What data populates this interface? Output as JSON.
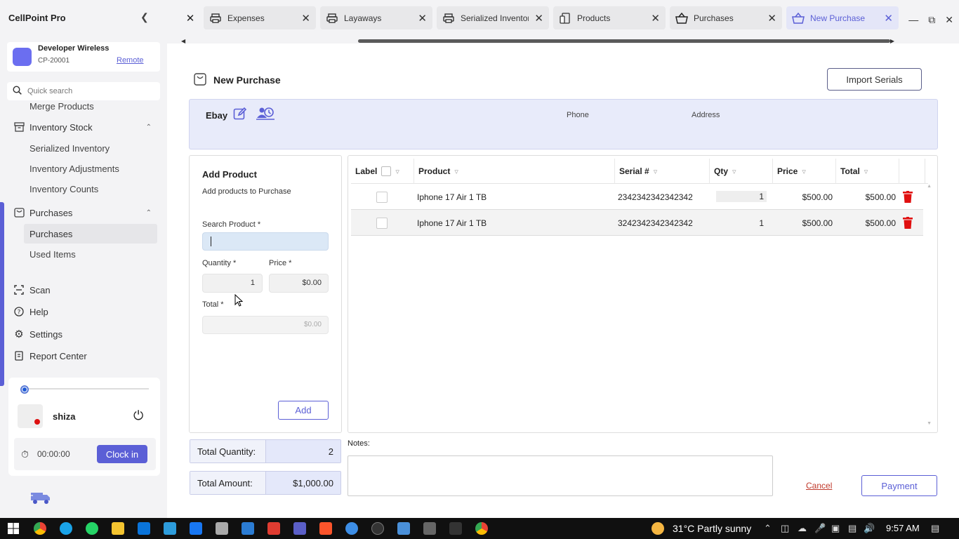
{
  "app": {
    "title": "CellPoint Pro"
  },
  "tabs": [
    {
      "label": "Expenses",
      "icon": "printer-icon",
      "active": false
    },
    {
      "label": "Layaways",
      "icon": "printer-icon",
      "active": false
    },
    {
      "label": "Serialized Inventory",
      "icon": "printer-icon",
      "active": false
    },
    {
      "label": "Products",
      "icon": "device-icon",
      "active": false
    },
    {
      "label": "Purchases",
      "icon": "basket-icon",
      "active": false
    },
    {
      "label": "New Purchase",
      "icon": "basket-icon",
      "active": true
    }
  ],
  "account": {
    "name": "Developer Wireless",
    "id": "CP-20001",
    "mode": "Remote"
  },
  "search": {
    "placeholder": "Quick search"
  },
  "nav": {
    "merge_products": "Merge Products",
    "inventory_stock": "Inventory Stock",
    "serialized_inventory": "Serialized Inventory",
    "inventory_adjustments": "Inventory Adjustments",
    "inventory_counts": "Inventory Counts",
    "purchases_group": "Purchases",
    "purchases": "Purchases",
    "used_items": "Used Items",
    "scan": "Scan",
    "help": "Help",
    "settings": "Settings",
    "report_center": "Report Center"
  },
  "user": {
    "name": "shiza",
    "timer": "00:00:00",
    "clock_in_label": "Clock in"
  },
  "page": {
    "title": "New Purchase",
    "import_label": "Import Serials"
  },
  "vendor": {
    "name": "Ebay",
    "phone_label": "Phone",
    "address_label": "Address"
  },
  "add_product": {
    "title": "Add Product",
    "subtitle": "Add products to Purchase",
    "search_label": "Search Product *",
    "search_value": "",
    "quantity_label": "Quantity *",
    "quantity_value": "1",
    "price_label": "Price *",
    "price_value": "$0.00",
    "total_label": "Total *",
    "total_value": "$0.00",
    "add_label": "Add"
  },
  "grid": {
    "columns": [
      "Label",
      "Product",
      "Serial #",
      "Qty",
      "Price",
      "Total"
    ],
    "rows": [
      {
        "product": "Iphone 17 Air 1 TB",
        "serial": "2342342342342342",
        "qty": "1",
        "price": "$500.00",
        "total": "$500.00"
      },
      {
        "product": "Iphone 17 Air 1 TB",
        "serial": "3242342342342342",
        "qty": "1",
        "price": "$500.00",
        "total": "$500.00"
      }
    ]
  },
  "summary": {
    "total_quantity_label": "Total Quantity:",
    "total_quantity": "2",
    "total_amount_label": "Total Amount:",
    "total_amount": "$1,000.00"
  },
  "notes": {
    "label": "Notes:",
    "value": ""
  },
  "actions": {
    "cancel": "Cancel",
    "payment": "Payment"
  },
  "taskbar": {
    "weather": "31°C  Partly sunny",
    "time": "9:57 AM"
  },
  "colors": {
    "accent": "#5b5fd6",
    "vendor_panel": "#e8ebfa",
    "delete": "#e01010"
  }
}
